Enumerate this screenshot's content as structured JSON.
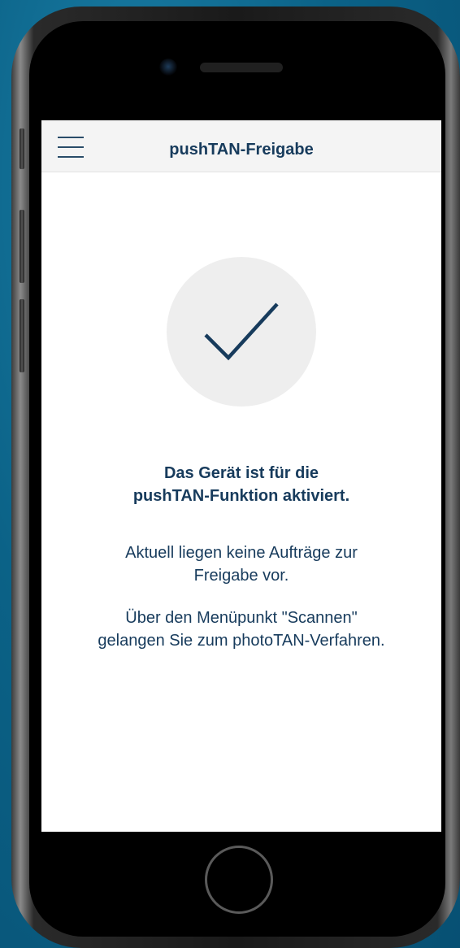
{
  "screen": {
    "title": "pushTAN-Freigabe",
    "menu_icon": "hamburger-menu-icon",
    "status_icon": "checkmark-icon",
    "headline_line1": "Das Gerät ist für die",
    "headline_line2": "pushTAN-Funktion aktiviert.",
    "info1_line1": "Aktuell liegen keine Aufträge zur",
    "info1_line2": "Freigabe vor.",
    "info2_line1": "Über den Menüpunkt \"Scannen\"",
    "info2_line2": "gelangen Sie zum photoTAN-Verfahren."
  },
  "colors": {
    "text": "#173b5c",
    "background": "#0b6287",
    "topbar": "#f4f4f4",
    "circle": "#eeeeee"
  }
}
